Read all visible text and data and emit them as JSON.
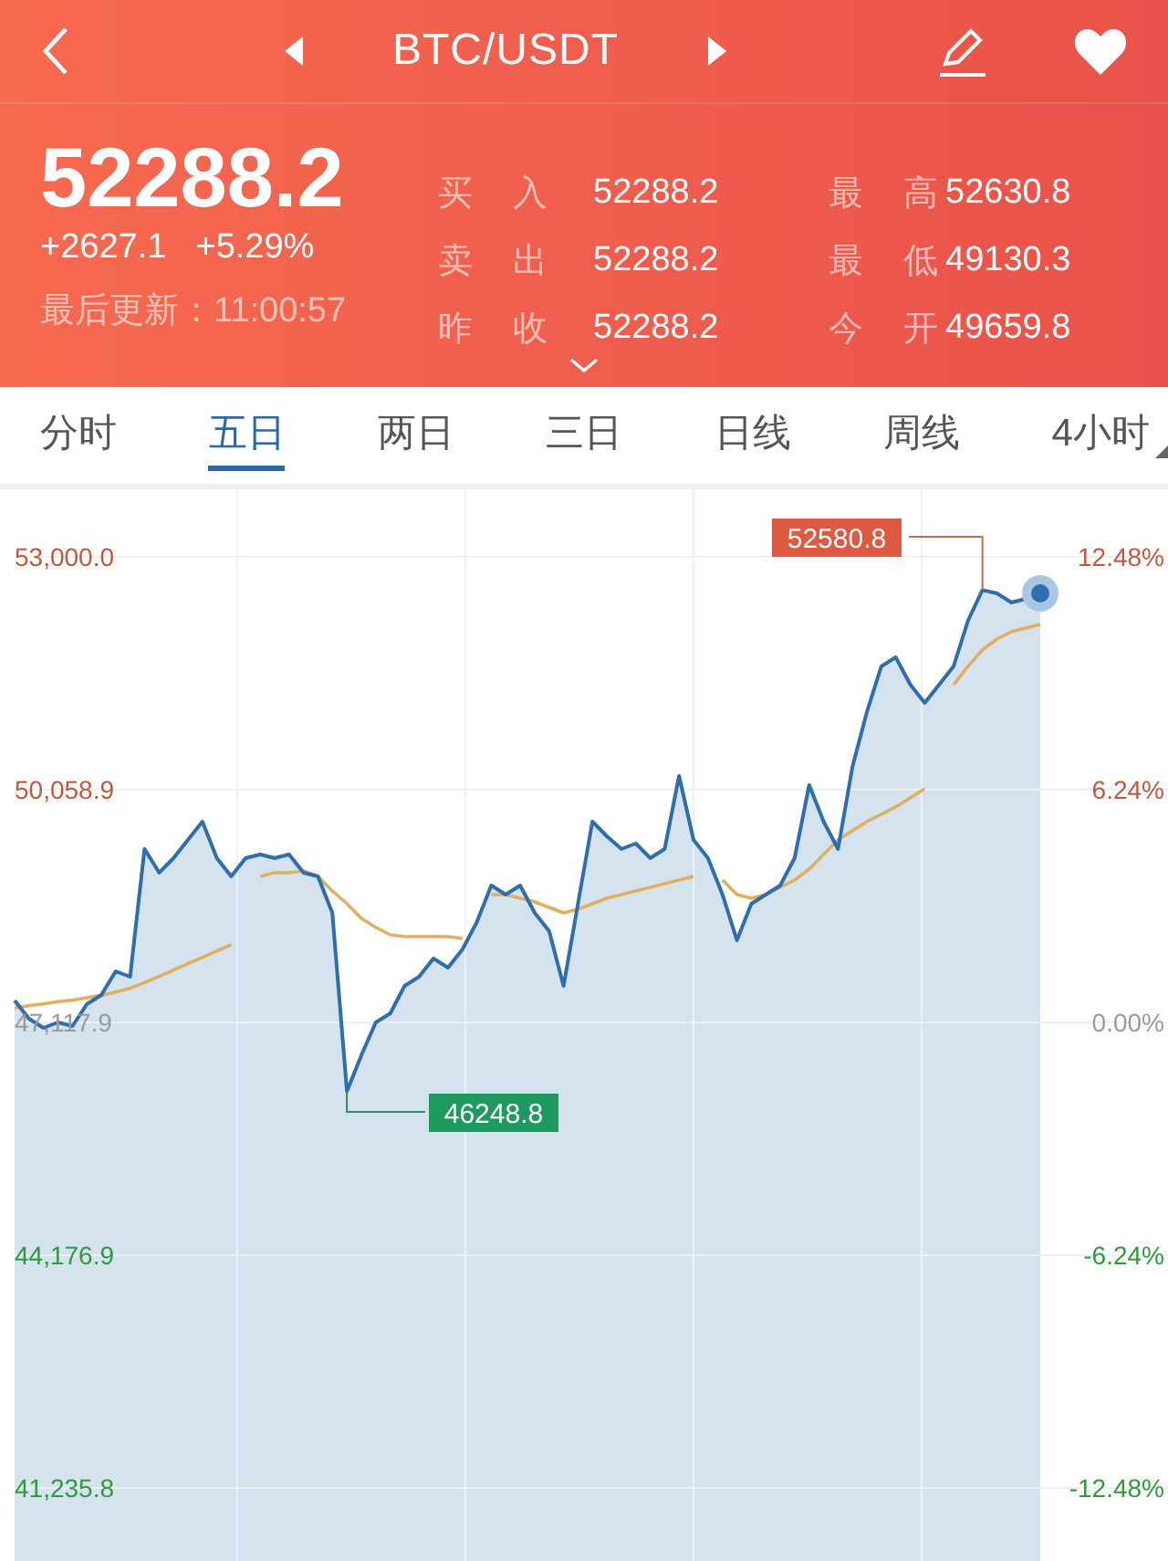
{
  "header": {
    "title": "BTC/USDT"
  },
  "quote": {
    "price": "52288.2",
    "change": "+2627.1",
    "change_percent": "+5.29%",
    "updated": "最后更新：11:00:57",
    "stats": [
      [
        {
          "label": "买入",
          "value": "52288.2"
        },
        {
          "label": "最高",
          "value": "52630.8"
        }
      ],
      [
        {
          "label": "卖出",
          "value": "52288.2"
        },
        {
          "label": "最低",
          "value": "49130.3"
        }
      ],
      [
        {
          "label": "昨收",
          "value": "52288.2"
        },
        {
          "label": "今开",
          "value": "49659.8"
        }
      ]
    ]
  },
  "tabs": [
    {
      "label": "分时",
      "selected": false,
      "kind": "plain"
    },
    {
      "label": "五日",
      "selected": true,
      "kind": "plain"
    },
    {
      "label": "两日",
      "selected": false,
      "kind": "plain"
    },
    {
      "label": "三日",
      "selected": false,
      "kind": "plain"
    },
    {
      "label": "日线",
      "selected": false,
      "kind": "plain"
    },
    {
      "label": "周线",
      "selected": false,
      "kind": "plain"
    },
    {
      "label": "4小时",
      "selected": false,
      "kind": "dropdown"
    }
  ],
  "chart": {
    "percent_labels": [
      {
        "label": "12.48%",
        "color": "#c0583e"
      },
      {
        "label": "6.24%",
        "color": "#c0583e"
      },
      {
        "label": "0.00%",
        "color": "#9a9a9a"
      },
      {
        "label": "-6.24%",
        "color": "#2e9a3c"
      },
      {
        "label": "-12.48%",
        "color": "#2e9a3c"
      }
    ],
    "chart_data": {
      "type": "area",
      "grid": true,
      "yticks": [
        {
          "value": 53000,
          "label": "53,000.0"
        },
        {
          "value": 50058.9,
          "label": "50,058.9"
        },
        {
          "value": 47117.9,
          "label": "47,117.9"
        },
        {
          "value": 44176.9,
          "label": "44,176.9"
        },
        {
          "value": 41235.8,
          "label": "41,235.8"
        }
      ],
      "ylim": [
        41235.8,
        53000
      ],
      "series": [
        {
          "color": "#2e6db0",
          "values": [
            47394,
            47163,
            47048,
            47117,
            47071,
            47348,
            47463,
            47763,
            47694,
            49309,
            49009,
            49193,
            49424,
            49655,
            49193,
            48963,
            49193,
            49240,
            49193,
            49240,
            49009,
            48963,
            48501,
            46249,
            46702,
            47117,
            47232,
            47579,
            47694,
            47925,
            47810,
            48040,
            48386,
            48847,
            48732,
            48847,
            48501,
            48271,
            47579,
            48617,
            49655,
            49470,
            49309,
            49378,
            49193,
            49309,
            50232,
            49424,
            49193,
            48732,
            48155,
            48617,
            48732,
            48847,
            49193,
            50116,
            49655,
            49309,
            50347,
            51039,
            51616,
            51731,
            51385,
            51154,
            51385,
            51616,
            52193,
            52581,
            52539,
            52423,
            52469,
            52539
          ]
        },
        {
          "type": "line",
          "color": "#e0b060",
          "values": [
            47300,
            47330,
            47350,
            47380,
            47400,
            47430,
            47460,
            47500,
            47550,
            47620,
            47700,
            47780,
            47860,
            47940,
            48020,
            48100,
            null,
            48963,
            49009,
            49009,
            49032,
            48963,
            48778,
            48617,
            48432,
            48317,
            48225,
            48201,
            48201,
            48201,
            48201,
            48178,
            null,
            48732,
            48732,
            48686,
            48640,
            48571,
            48501,
            48547,
            48617,
            48686,
            48732,
            48778,
            48824,
            48870,
            48917,
            48963,
            null,
            48917,
            48732,
            48686,
            48732,
            48824,
            48917,
            49055,
            49240,
            49424,
            49540,
            49655,
            49747,
            49839,
            49955,
            50070,
            null,
            51385,
            51616,
            51824,
            51962,
            52054,
            52100,
            52146
          ]
        }
      ],
      "annotations": [
        "52580.8",
        "46248.8"
      ]
    }
  }
}
